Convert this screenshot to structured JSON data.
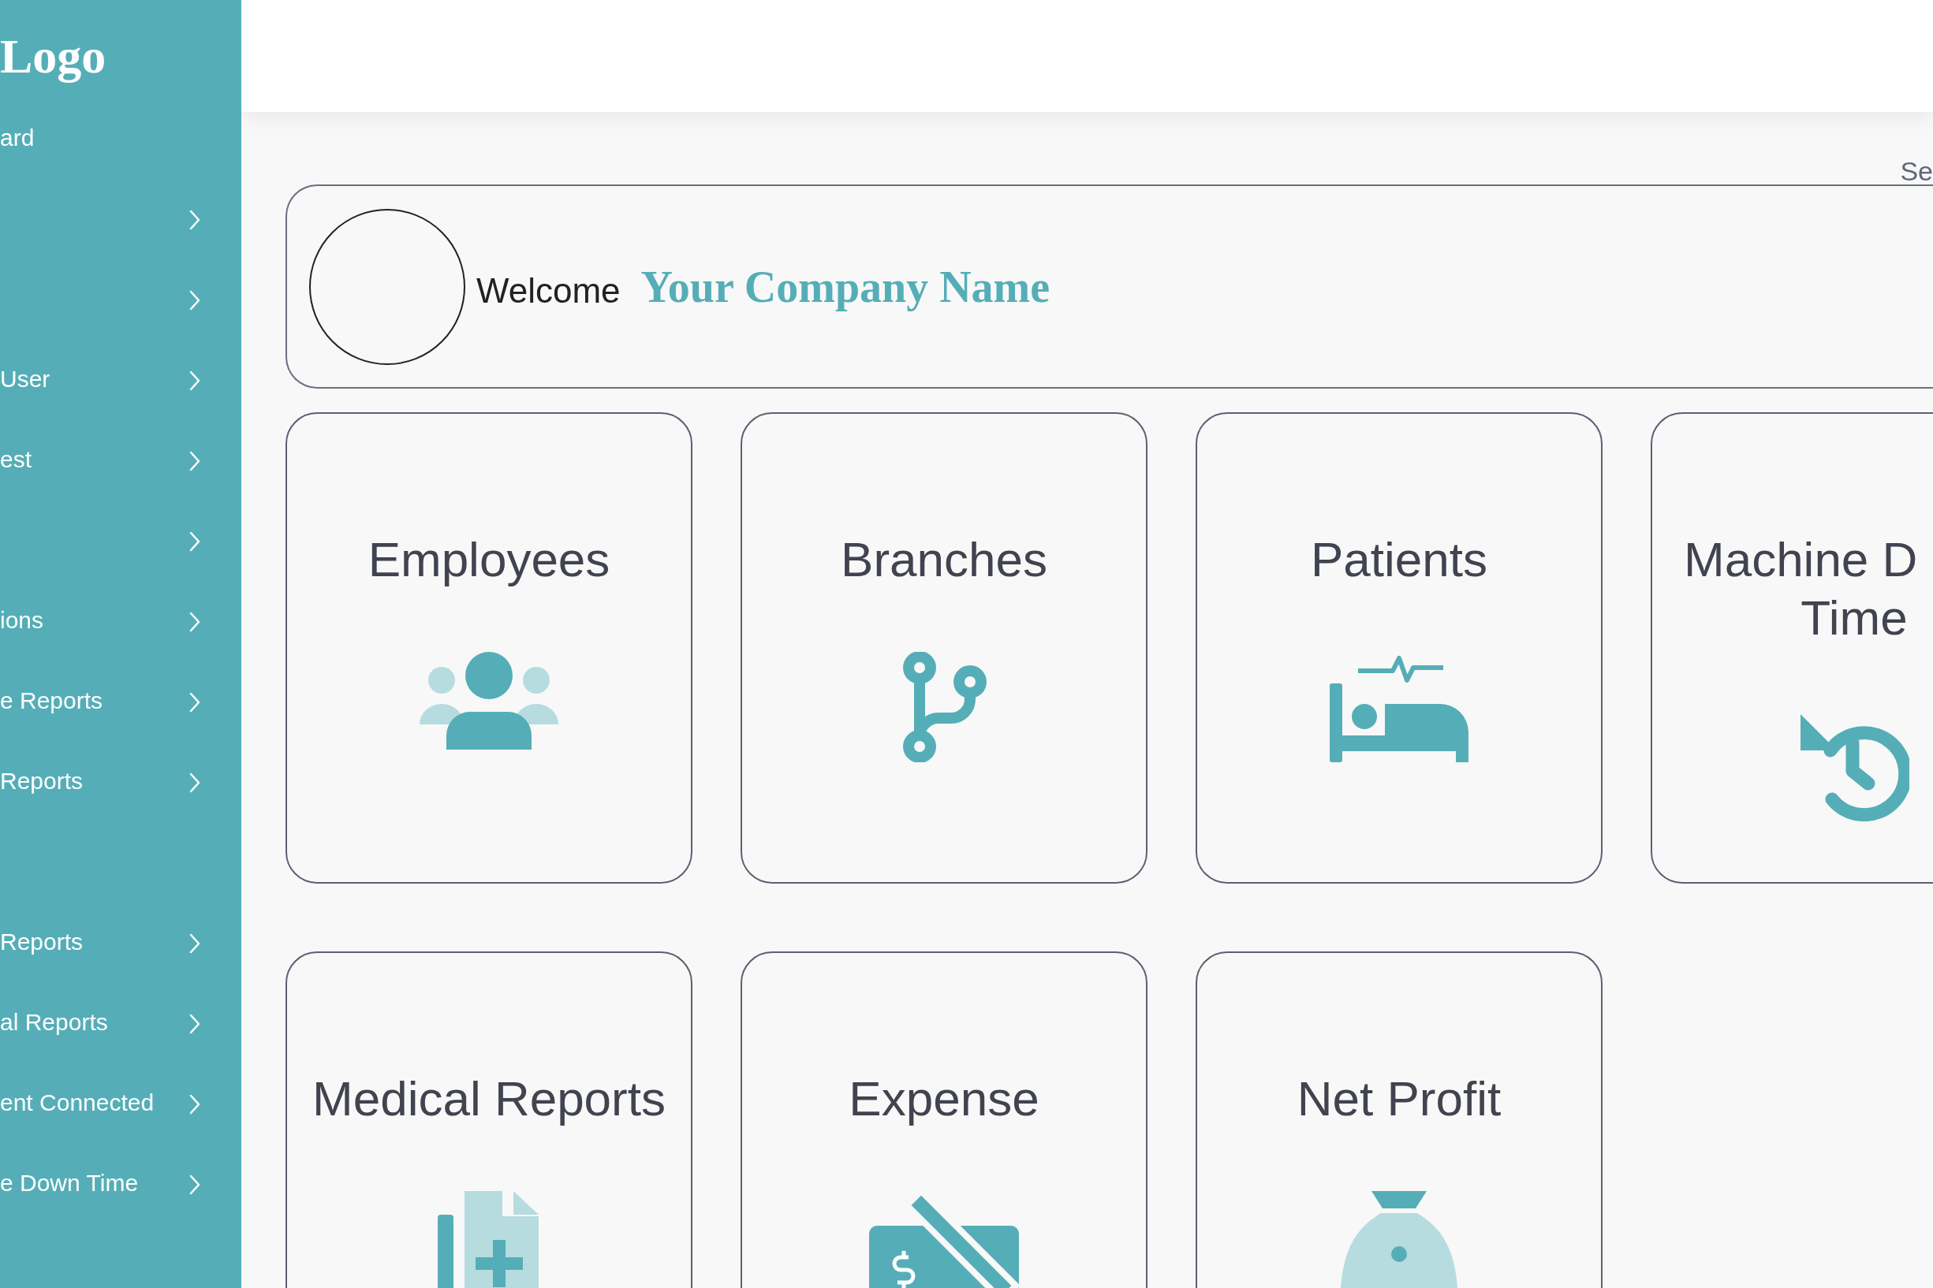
{
  "sidebar": {
    "logo": "Logo",
    "items": [
      {
        "kind": "link",
        "label": "ard",
        "chevron": false
      },
      {
        "kind": "link",
        "chevron": true
      },
      {
        "kind": "link",
        "chevron": true
      },
      {
        "kind": "link",
        "label": "User",
        "chevron": true
      },
      {
        "kind": "link",
        "label": "est",
        "chevron": true
      },
      {
        "kind": "link",
        "chevron": true
      },
      {
        "kind": "link",
        "label": "ions",
        "chevron": true
      },
      {
        "kind": "link",
        "label": "e Reports",
        "chevron": true
      },
      {
        "kind": "link",
        "label": "Reports",
        "chevron": true
      },
      {
        "kind": "spacer"
      },
      {
        "kind": "link",
        "label": "Reports",
        "chevron": true
      },
      {
        "kind": "link",
        "label": "al Reports",
        "chevron": true
      },
      {
        "kind": "link",
        "label": "ent Connected",
        "chevron": true
      },
      {
        "kind": "link",
        "label": "e Down Time",
        "chevron": true
      }
    ]
  },
  "top_right_text": "Se",
  "welcome": {
    "greeting": "Welcome",
    "company": "Your Company Name"
  },
  "cards": [
    {
      "kind": "users",
      "title_lines": [
        "Employees"
      ]
    },
    {
      "kind": "branch",
      "title_lines": [
        "Branches"
      ]
    },
    {
      "kind": "bed",
      "title_lines": [
        "Patients"
      ]
    },
    {
      "kind": "history",
      "title_lines": [
        "Machine D",
        "Time"
      ]
    },
    {
      "kind": "medical",
      "title_lines": [
        "Medical Reports"
      ]
    },
    {
      "kind": "expense",
      "title_lines": [
        "Expense"
      ]
    },
    {
      "kind": "moneybag",
      "title_lines": [
        "Net Profit"
      ]
    }
  ]
}
